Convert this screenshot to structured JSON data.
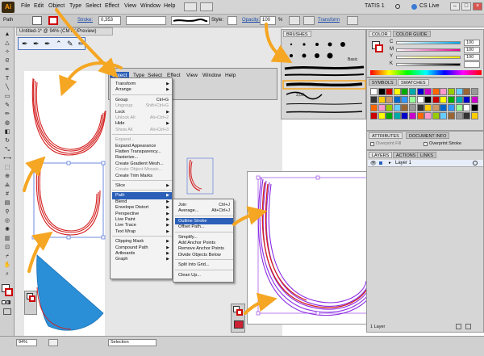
{
  "menubar": {
    "logo": "Ai",
    "items": [
      "File",
      "Edit",
      "Object",
      "Type",
      "Select",
      "Effect",
      "View",
      "Window",
      "Help"
    ],
    "workspace": "TATIS 1",
    "cs_live": "CS Live"
  },
  "control_bar": {
    "selection_label": "Path",
    "stroke_label": "Stroke:",
    "stroke_value": "0,353",
    "style_label": "Style:",
    "opacity_label": "Opacity:",
    "opacity_value": "100",
    "opacity_unit": "%",
    "transform_link": "Transform"
  },
  "document": {
    "tab_title": "Untitled-1* @ 94% (CMYK/Preview)",
    "zoom": "94%",
    "status_tool": "Selection"
  },
  "inset_menubar": {
    "items": [
      "Object",
      "Type",
      "Select",
      "Effect",
      "View",
      "Window",
      "Help"
    ]
  },
  "object_menu": {
    "items": [
      {
        "label": "Transform",
        "arrow": true
      },
      {
        "label": "Arrange",
        "arrow": true
      },
      {
        "sep": true
      },
      {
        "label": "Group",
        "shortcut": "Ctrl+G"
      },
      {
        "label": "Ungroup",
        "shortcut": "Shift+Ctrl+G",
        "disabled": true
      },
      {
        "label": "Lock",
        "arrow": true
      },
      {
        "label": "Unlock All",
        "shortcut": "Alt+Ctrl+2",
        "disabled": true
      },
      {
        "label": "Hide",
        "arrow": true
      },
      {
        "label": "Show All",
        "shortcut": "Alt+Ctrl+3",
        "disabled": true
      },
      {
        "sep": true
      },
      {
        "label": "Expand...",
        "disabled": true
      },
      {
        "label": "Expand Appearance"
      },
      {
        "label": "Flatten Transparency..."
      },
      {
        "label": "Rasterize..."
      },
      {
        "label": "Create Gradient Mesh..."
      },
      {
        "label": "Create Object Mosaic...",
        "disabled": true
      },
      {
        "label": "Create Trim Marks"
      },
      {
        "sep": true
      },
      {
        "label": "Slice",
        "arrow": true
      },
      {
        "sep": true
      },
      {
        "label": "Path",
        "arrow": true,
        "highlight": true
      },
      {
        "label": "Blend",
        "arrow": true
      },
      {
        "label": "Envelope Distort",
        "arrow": true
      },
      {
        "label": "Perspective",
        "arrow": true
      },
      {
        "label": "Live Paint",
        "arrow": true
      },
      {
        "label": "Live Trace",
        "arrow": true
      },
      {
        "label": "Text Wrap",
        "arrow": true
      },
      {
        "sep": true
      },
      {
        "label": "Clipping Mask",
        "arrow": true
      },
      {
        "label": "Compound Path",
        "arrow": true
      },
      {
        "label": "Artboards",
        "arrow": true
      },
      {
        "label": "Graph",
        "arrow": true
      }
    ]
  },
  "path_menu": {
    "items": [
      {
        "label": "Join",
        "shortcut": "Ctrl+J"
      },
      {
        "label": "Average...",
        "shortcut": "Alt+Ctrl+J"
      },
      {
        "sep": true
      },
      {
        "label": "Outline Stroke",
        "highlight": true
      },
      {
        "label": "Offset Path..."
      },
      {
        "sep": true
      },
      {
        "label": "Simplify..."
      },
      {
        "label": "Add Anchor Points"
      },
      {
        "label": "Remove Anchor Points"
      },
      {
        "label": "Divide Objects Below"
      },
      {
        "sep": true
      },
      {
        "label": "Split Into Grid..."
      },
      {
        "sep": true
      },
      {
        "label": "Clean Up..."
      }
    ]
  },
  "brushes_panel": {
    "tab": "BRUSHES",
    "basic_label": "Basic",
    "size_value": "3,00"
  },
  "color_panel": {
    "tab_color": "COLOR",
    "tab_guide": "COLOR GUIDE",
    "channels": [
      {
        "letter": "C",
        "value": "100",
        "color": "#00a8e8"
      },
      {
        "letter": "M",
        "value": "100",
        "color": "#e8008a"
      },
      {
        "letter": "Y",
        "value": "100",
        "color": "#ffe600"
      },
      {
        "letter": "K",
        "value": "",
        "color": "#000000"
      }
    ]
  },
  "swatches_panel": {
    "tab_symbols": "SYMBOLS",
    "tab_swatches": "SWATCHES"
  },
  "attributes_panel": {
    "tab_attributes": "ATTRIBUTES",
    "tab_docinfo": "DOCUMENT INFO",
    "overprint_fill": "Overprint Fill",
    "overprint_stroke": "Overprint Stroke"
  },
  "layers_panel": {
    "tab_layers": "LAYERS",
    "tab_actions": "ACTIONS",
    "tab_links": "LINKS",
    "layer_name": "Layer 1",
    "footer": "1 Layer"
  },
  "colors": {
    "accent_arrow": "#f5a623",
    "highlight": "#2b5fb8",
    "stroke_red": "#d42020",
    "stroke_purple": "#8a2be2",
    "blue_shape": "#2a8fd6"
  }
}
